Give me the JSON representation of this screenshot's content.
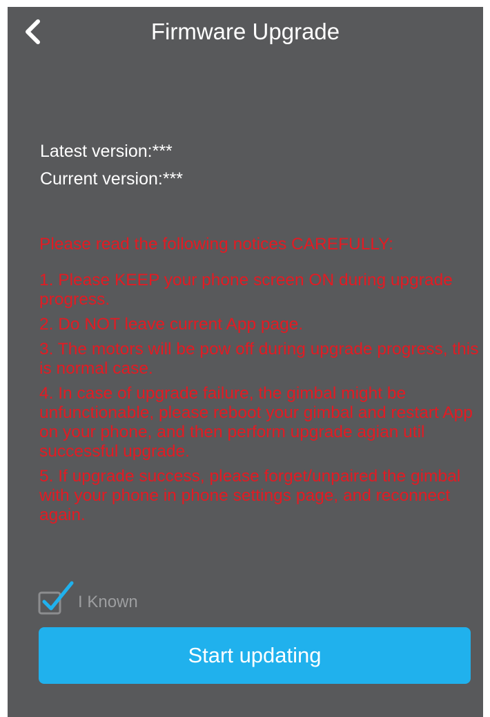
{
  "header": {
    "back_icon": "chevron-left-icon",
    "title": "Firmware Upgrade"
  },
  "versions": {
    "latest": "Latest version:***",
    "current": "Current version:***"
  },
  "notices": {
    "heading": "Please read the following notices CAREFULLY:",
    "items": [
      "1. Please KEEP your phone screen ON during upgrade progress.",
      "2. Do NOT leave current App page.",
      "3. The motors will be pow off during upgrade progress, this is normal case.",
      "4. In case of upgrade failure, the gimbal might be unfunctionable,  please reboot your gimbal and restart App on your phone, and then perform upgrade agian util successful upgrade.",
      "5. If upgrade success, please forget/unpaired the gimbal with your phone in phone settings page, and reconnect again."
    ],
    "color": "#e21b23"
  },
  "confirm": {
    "label": "I Known",
    "checked": true,
    "icon": "checkbox-checked-icon",
    "check_color": "#20b1ed"
  },
  "actions": {
    "start_label": "Start updating",
    "button_color": "#20b1ed"
  },
  "colors": {
    "background": "#58595b",
    "text": "#ffffff"
  }
}
